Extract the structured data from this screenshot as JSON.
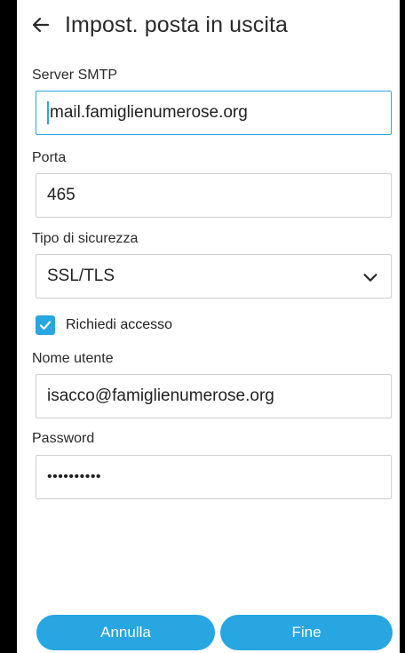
{
  "header": {
    "title": "Impost. posta in uscita",
    "back_icon": "arrow-left-icon"
  },
  "smtp": {
    "label": "Server SMTP",
    "value": "mail.famiglienumerose.org"
  },
  "port": {
    "label": "Porta",
    "value": "465"
  },
  "security": {
    "label": "Tipo di sicurezza",
    "value": "SSL/TLS",
    "chevron_icon": "chevron-down-icon"
  },
  "login": {
    "label": "Richiedi accesso",
    "checked": true
  },
  "username": {
    "label": "Nome utente",
    "value": "isacco@famiglienumerose.org"
  },
  "password": {
    "label": "Password",
    "value": "••••••••••"
  },
  "buttons": {
    "cancel": "Annulla",
    "done": "Fine"
  },
  "colors": {
    "accent": "#27a6e1",
    "border": "#cfcfcf",
    "text": "#222222"
  }
}
